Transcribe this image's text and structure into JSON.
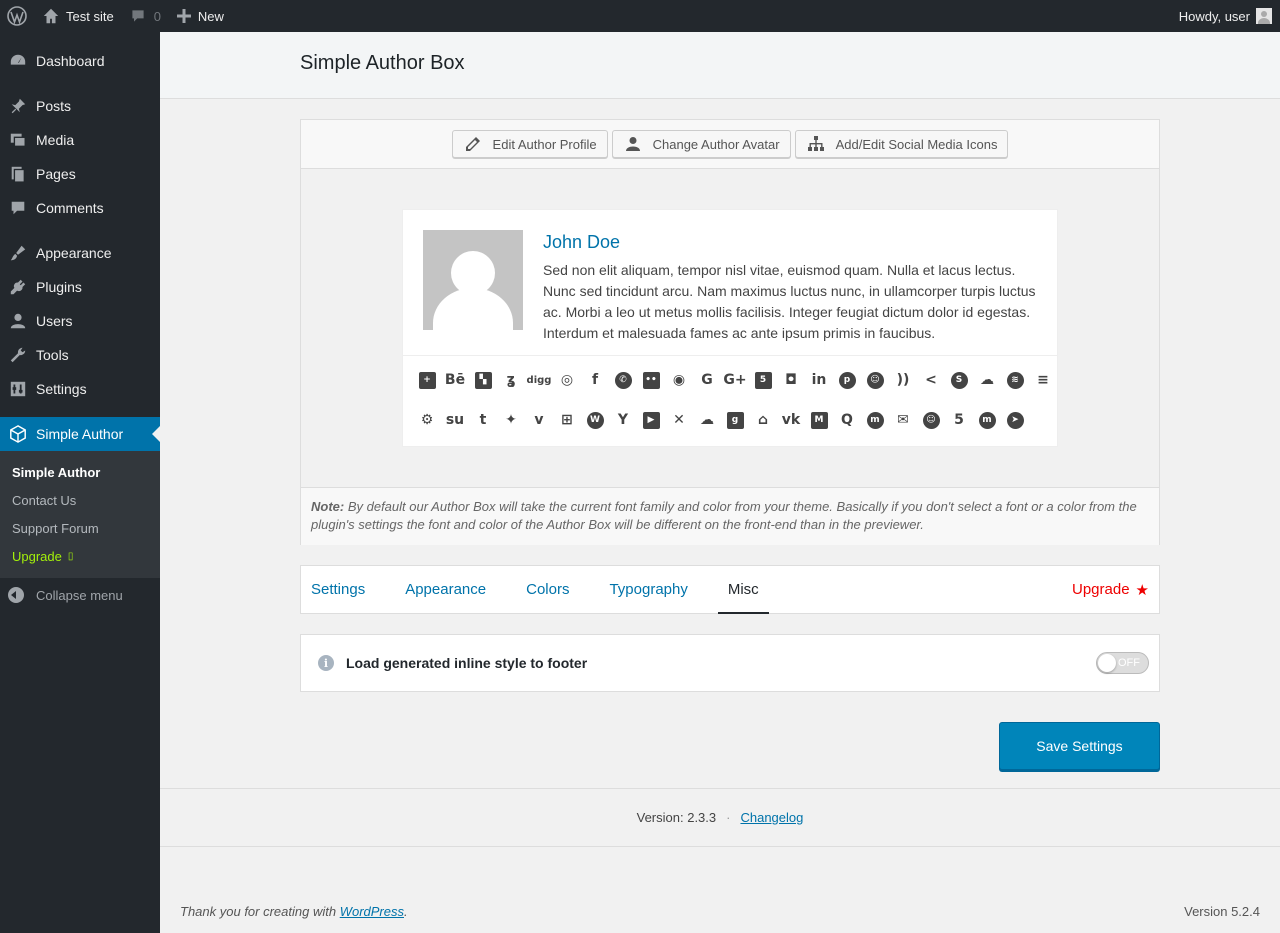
{
  "adminbar": {
    "site_name": "Test site",
    "comments_count": "0",
    "new_label": "New",
    "greeting": "Howdy, user"
  },
  "sidebar": {
    "items": [
      {
        "label": "Dashboard",
        "icon": "dashboard-icon"
      },
      {
        "label": "Posts",
        "icon": "pin-icon"
      },
      {
        "label": "Media",
        "icon": "media-icon"
      },
      {
        "label": "Pages",
        "icon": "pages-icon"
      },
      {
        "label": "Comments",
        "icon": "comment-icon"
      },
      {
        "label": "Appearance",
        "icon": "brush-icon"
      },
      {
        "label": "Plugins",
        "icon": "plugin-icon"
      },
      {
        "label": "Users",
        "icon": "user-icon"
      },
      {
        "label": "Tools",
        "icon": "wrench-icon"
      },
      {
        "label": "Settings",
        "icon": "settings-icon"
      },
      {
        "label": "Simple Author",
        "icon": "cube-icon"
      }
    ],
    "submenu": [
      "Simple Author",
      "Contact Us",
      "Support Forum",
      "Upgrade"
    ],
    "collapse_label": "Collapse menu"
  },
  "page": {
    "title": "Simple Author Box"
  },
  "toolbar": {
    "edit_profile": "Edit Author Profile",
    "change_avatar": "Change Author Avatar",
    "social_icons": "Add/Edit Social Media Icons"
  },
  "author": {
    "name": "John Doe",
    "bio": "Sed non elit aliquam, tempor nisl vitae, euismod quam. Nulla et lacus lectus. Nunc sed tincidunt arcu. Nam maximus luctus nunc, in ullamcorper turpis luctus ac. Morbi a leo ut metus mollis facilisis. Integer feugiat dictum dolor id egestas. Interdum et malesuada fames ac ante ipsum primis in faucibus."
  },
  "social_row1": [
    "addthis-icon",
    "behance-icon",
    "delicious-icon",
    "deviantart-icon",
    "digg-icon",
    "dribbble-icon",
    "facebook-icon",
    "whatsapp-icon",
    "flickr-icon",
    "github-icon",
    "google-icon",
    "googleplus-icon",
    "html5-icon",
    "instagram-icon",
    "linkedin-icon",
    "pinterest-icon",
    "reddit-icon",
    "rss-icon",
    "sharethis-icon",
    "skype-icon",
    "soundcloud-icon",
    "spotify-icon",
    "stackoverflow-icon"
  ],
  "social_row2": [
    "steam-icon",
    "stumbleupon-icon",
    "tumblr-icon",
    "twitter-icon",
    "vimeo-icon",
    "windows-icon",
    "wordpress-icon",
    "yahoo-icon",
    "youtube-icon",
    "xing-icon",
    "mixcloud-icon",
    "goodreads-icon",
    "twitch-icon",
    "vk-icon",
    "medium-icon",
    "quora-icon",
    "meetup-icon",
    "email-icon",
    "snapchat-icon",
    "500px-icon",
    "mastodon-icon",
    "telegram-icon"
  ],
  "note": {
    "label": "Note:",
    "text": " By default our Author Box will take the current font family and color from your theme. Basically if you don't select a font or a color from the plugin's settings the font and color of the Author Box will be different on the front-end than in the previewer."
  },
  "tabs": [
    "Settings",
    "Appearance",
    "Colors",
    "Typography",
    "Misc"
  ],
  "active_tab": "Misc",
  "upgrade_tab": "Upgrade",
  "setting": {
    "label": "Load generated inline style to footer",
    "toggle_state": "OFF"
  },
  "save_label": "Save Settings",
  "version": {
    "text": "Version: 2.3.3",
    "separator": "·",
    "changelog": "Changelog"
  },
  "footer": {
    "thanks_prefix": "Thank you for creating with ",
    "thanks_link": "WordPress",
    "thanks_suffix": ".",
    "wp_version": "Version 5.2.4"
  },
  "colors": {
    "admin_bg": "#23282d",
    "accent": "#0073aa",
    "upgrade_green": "#a3f00a",
    "upgrade_red": "#e00000"
  }
}
